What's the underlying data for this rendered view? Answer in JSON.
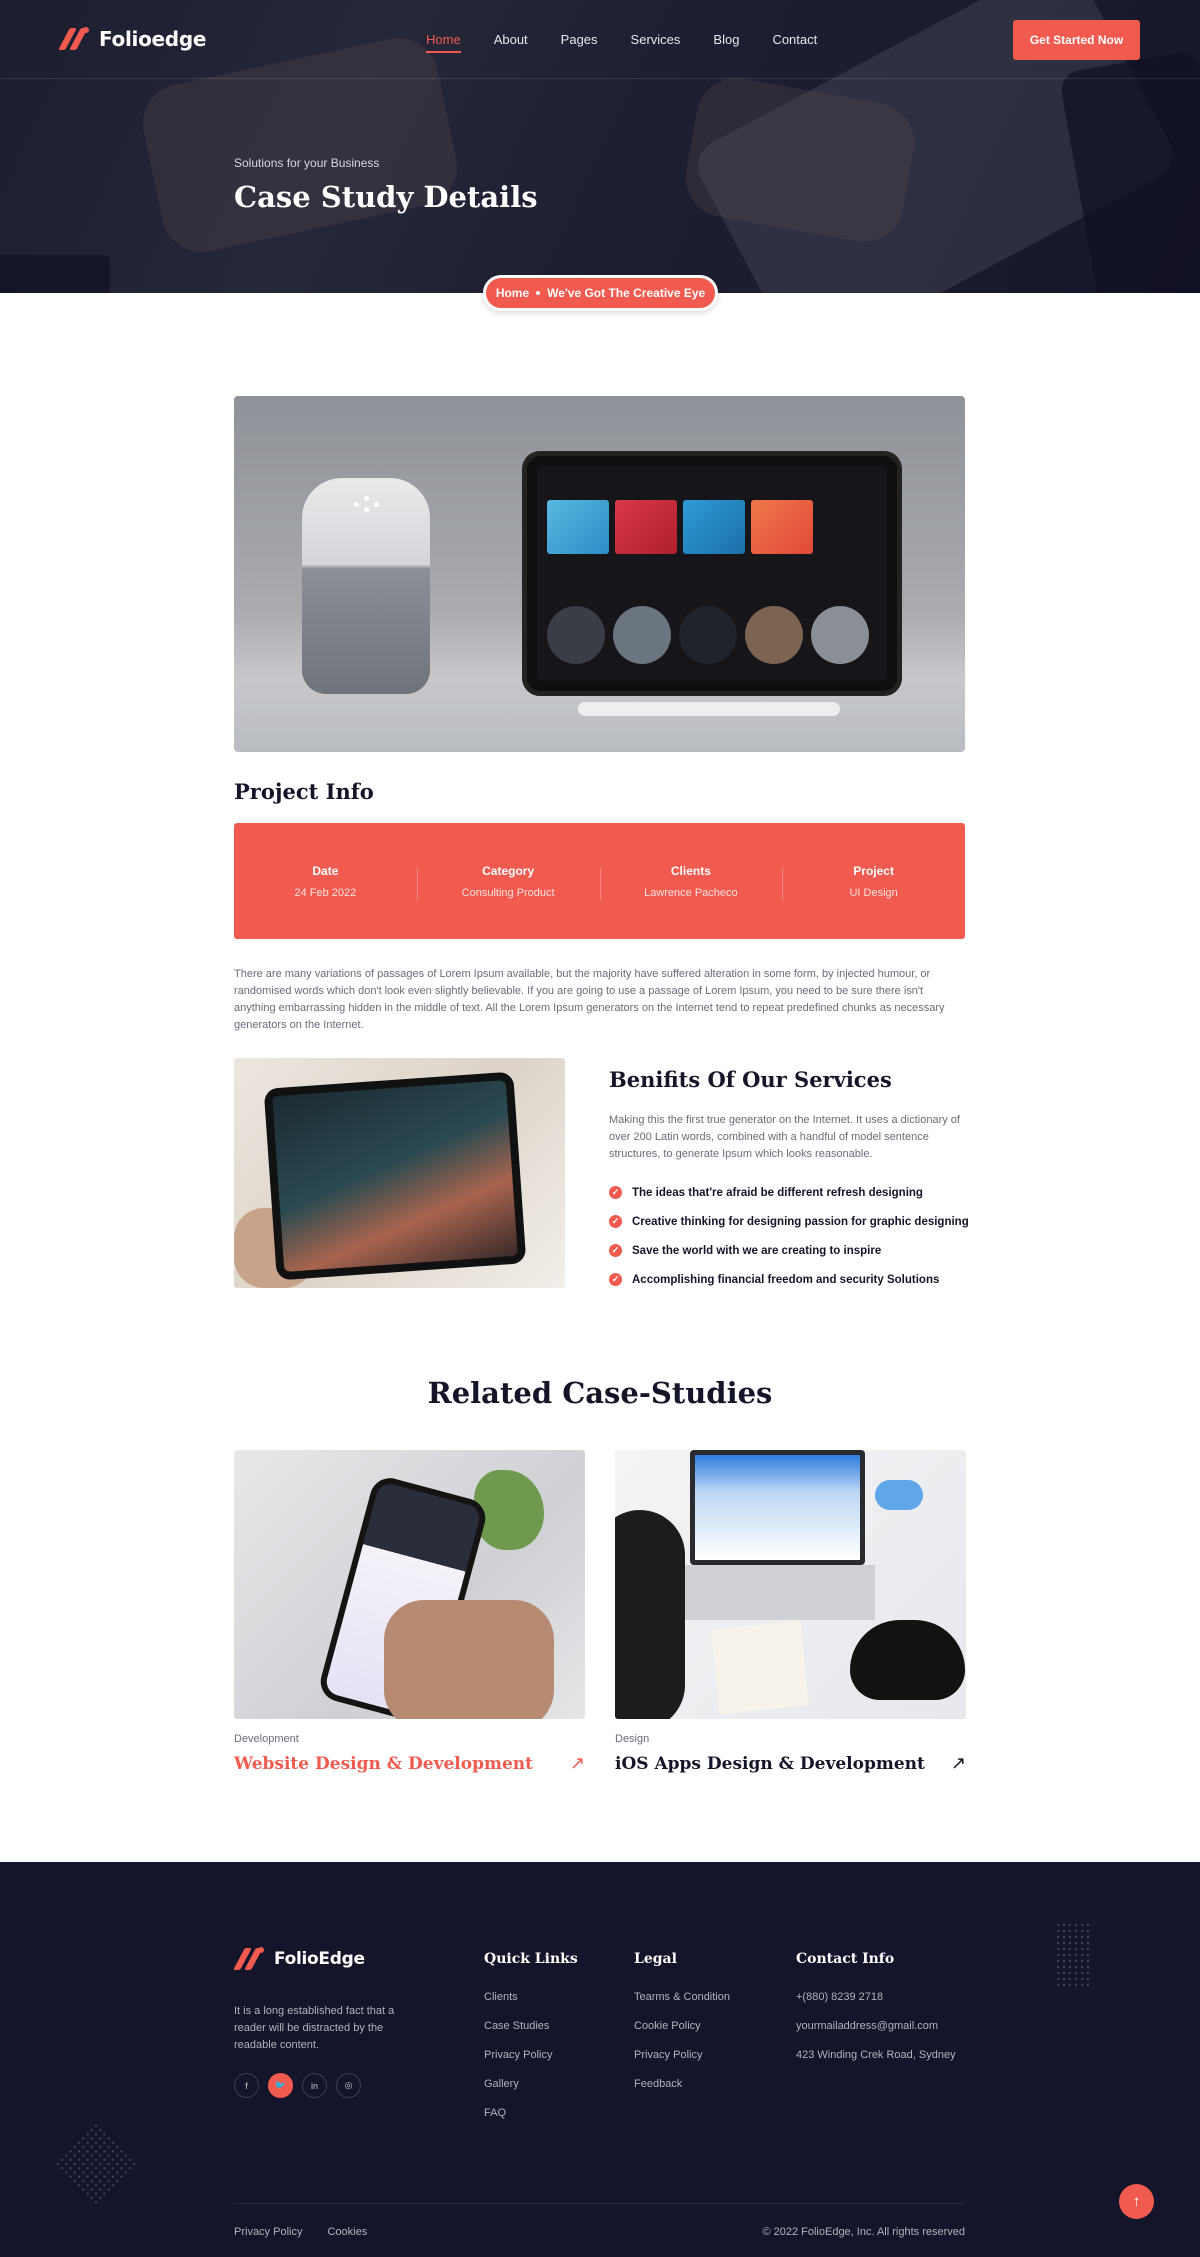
{
  "brand": {
    "name": "Folioedge",
    "footer_name": "FolioEdge",
    "accent": "#f15a4e",
    "dark": "#14142a"
  },
  "nav": {
    "items": [
      {
        "label": "Home",
        "active": true
      },
      {
        "label": "About",
        "active": false
      },
      {
        "label": "Pages",
        "active": false
      },
      {
        "label": "Services",
        "active": false
      },
      {
        "label": "Blog",
        "active": false
      },
      {
        "label": "Contact",
        "active": false
      }
    ],
    "cta": "Get Started Now"
  },
  "hero": {
    "subtitle": "Solutions for your Business",
    "title": "Case Study Details",
    "breadcrumb": {
      "home": "Home",
      "current": "We've Got The Creative Eye"
    }
  },
  "project": {
    "heading": "Project Info",
    "info": [
      {
        "label": "Date",
        "value": "24 Feb 2022"
      },
      {
        "label": "Category",
        "value": "Consulting Product"
      },
      {
        "label": "Clients",
        "value": "Lawrence Pacheco"
      },
      {
        "label": "Project",
        "value": "UI Design"
      }
    ],
    "description": "There are many variations of passages of Lorem Ipsum available, but the majority have suffered alteration in some form, by injected humour, or randomised words which don't look even slightly believable. If you are going to use a passage of Lorem Ipsum, you need to be sure there isn't anything embarrassing hidden in the middle of text. All the Lorem Ipsum generators on the Internet tend to repeat predefined chunks as necessary generators on the Internet."
  },
  "benefits": {
    "title": "Benifits Of Our Services",
    "text": "Making this the first true generator on the Internet. It uses a dictionary of over 200 Latin words, combined with a handful of model sentence structures, to generate Ipsum which looks reasonable.",
    "items": [
      "The ideas that're afraid be different refresh designing",
      "Creative thinking for designing passion for graphic designing",
      "Save the world with we are creating to inspire",
      "Accomplishing financial freedom and security Solutions"
    ]
  },
  "related": {
    "title": "Related Case-Studies",
    "cards": [
      {
        "category": "Development",
        "title": "Website Design & Development",
        "highlight": true
      },
      {
        "category": "Design",
        "title": "iOS Apps Design & Development",
        "highlight": false
      }
    ]
  },
  "footer": {
    "about": "It is a long established fact that a reader will be distracted by the readable content.",
    "socials": [
      "f",
      "t",
      "in",
      "ig"
    ],
    "quick_links": {
      "title": "Quick Links",
      "items": [
        "Clients",
        "Case Studies",
        "Privacy Policy",
        "Gallery",
        "FAQ"
      ]
    },
    "legal": {
      "title": "Legal",
      "items": [
        "Tearms & Condition",
        "Cookie Policy",
        "Privacy Policy",
        "Feedback"
      ]
    },
    "contact": {
      "title": "Contact Info",
      "items": [
        "+(880) 8239 2718",
        "yourmailaddress@gmail.com",
        "423 Winding Crek Road, Sydney"
      ]
    },
    "bottom_links": [
      "Privacy Policy",
      "Cookies"
    ],
    "copyright": "© 2022 FolioEdge, Inc. All rights reserved"
  }
}
